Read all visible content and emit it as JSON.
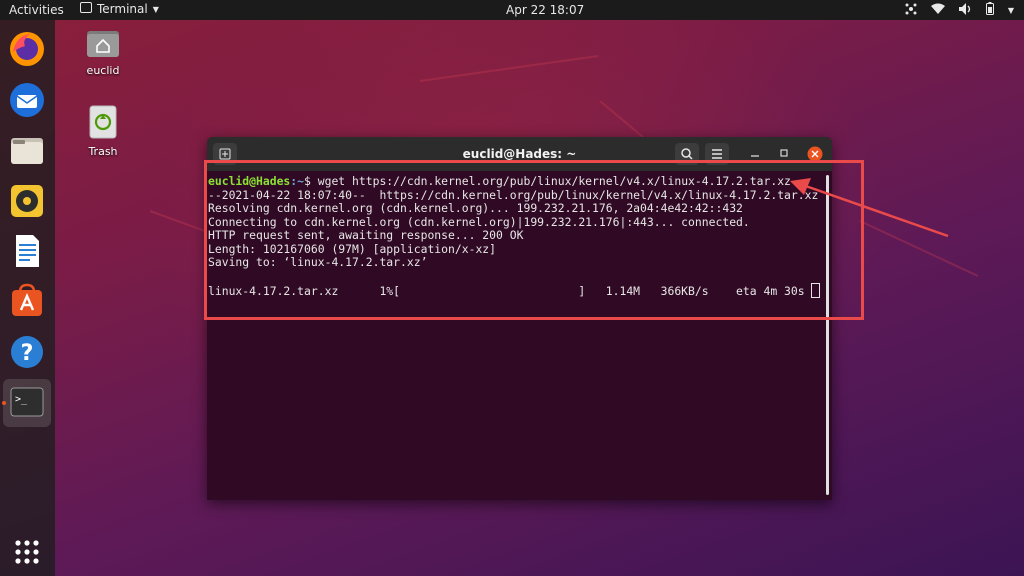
{
  "topbar": {
    "activities": "Activities",
    "app_name": "Terminal",
    "clock": "Apr 22  18:07"
  },
  "dock": {
    "items": [
      {
        "name": "Firefox",
        "icon": "firefox-icon"
      },
      {
        "name": "Thunderbird",
        "icon": "thunderbird-icon"
      },
      {
        "name": "Files",
        "icon": "files-icon"
      },
      {
        "name": "Rhythmbox",
        "icon": "rhythmbox-icon"
      },
      {
        "name": "LibreOffice Writer",
        "icon": "writer-icon"
      },
      {
        "name": "Ubuntu Software",
        "icon": "software-icon"
      },
      {
        "name": "Help",
        "icon": "help-icon"
      },
      {
        "name": "Terminal",
        "icon": "terminal-icon"
      }
    ],
    "show_apps_icon": "grid-icon"
  },
  "desktop": {
    "icons": [
      {
        "label": "euclid",
        "icon": "home-folder-icon"
      },
      {
        "label": "Trash",
        "icon": "trash-icon"
      }
    ]
  },
  "terminal": {
    "title": "euclid@Hades: ~",
    "prompt_user": "euclid@Hades",
    "prompt_path": ":~",
    "prompt_symbol": "$ ",
    "command": "wget https://cdn.kernel.org/pub/linux/kernel/v4.x/linux-4.17.2.tar.xz",
    "output": [
      "--2021-04-22 18:07:40--  https://cdn.kernel.org/pub/linux/kernel/v4.x/linux-4.17.2.tar.xz",
      "Resolving cdn.kernel.org (cdn.kernel.org)... 199.232.21.176, 2a04:4e42:42::432",
      "Connecting to cdn.kernel.org (cdn.kernel.org)|199.232.21.176|:443... connected.",
      "HTTP request sent, awaiting response... 200 OK",
      "Length: 102167060 (97M) [application/x-xz]",
      "Saving to: ‘linux-4.17.2.tar.xz’"
    ],
    "progress_line": "linux-4.17.2.tar.xz      1%[                          ]   1.14M   366KB/s    eta 4m 30s ",
    "progress_fraction": 0.01
  },
  "colors": {
    "annotation": "#ea4a4a",
    "prompt_user": "#8ae234",
    "prompt_path": "#729fcf",
    "terminal_bg": "#300a24",
    "accent": "#e95420"
  }
}
